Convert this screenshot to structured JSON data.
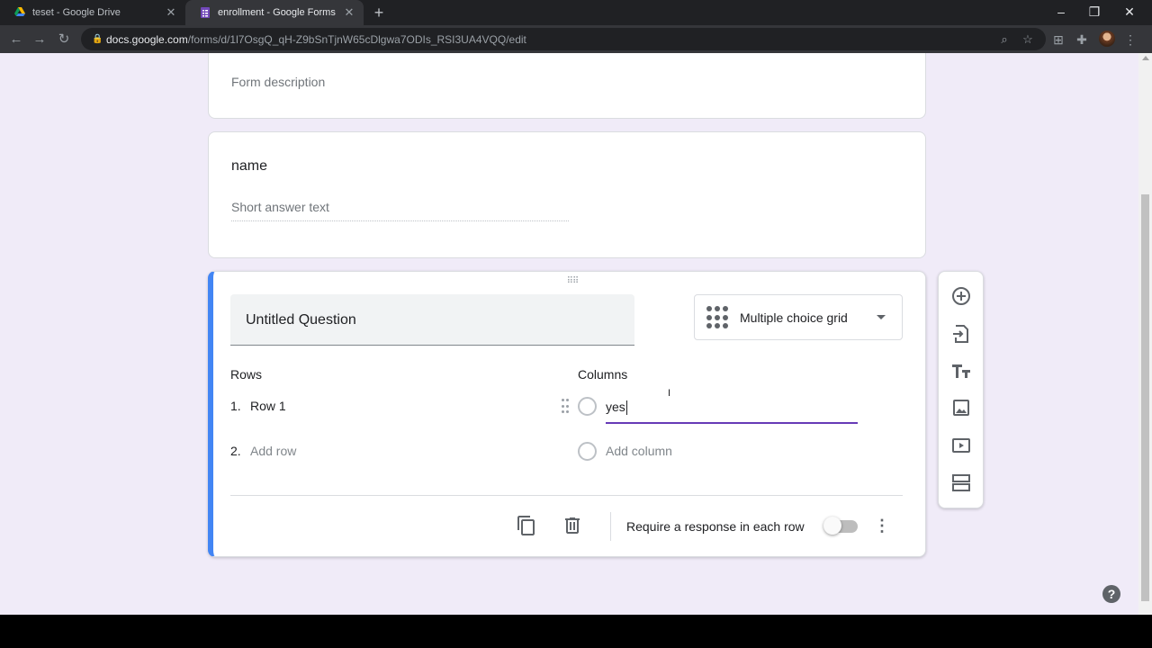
{
  "browser": {
    "tabs": [
      {
        "title": "teset - Google Drive",
        "active": false
      },
      {
        "title": "enrollment - Google Forms",
        "active": true
      }
    ],
    "url_host": "docs.google.com",
    "url_path": "/forms/d/1l7OsgQ_qH-Z9bSnTjnW65cDlgwa7ODIs_RSI3UA4VQQ/edit"
  },
  "form": {
    "description_placeholder": "Form description",
    "questions": [
      {
        "title": "name",
        "answer_placeholder": "Short answer text"
      },
      {
        "title": "Untitled Question",
        "type": "Multiple choice grid",
        "rows_header": "Rows",
        "columns_header": "Columns",
        "rows": [
          {
            "num": "1.",
            "label": "Row 1"
          },
          {
            "num": "2.",
            "label": "Add row"
          }
        ],
        "columns": [
          {
            "value": "yes"
          },
          {
            "label": "Add column"
          }
        ],
        "require_label": "Require a response in each row",
        "require_on": false
      }
    ]
  },
  "side_toolbar": [
    "add-question-icon",
    "import-questions-icon",
    "add-title-icon",
    "add-image-icon",
    "add-video-icon",
    "add-section-icon"
  ],
  "help": "?",
  "colors": {
    "accent": "#673ab7",
    "active_bar": "#4285f4",
    "page_bg": "#f0ebf8"
  }
}
